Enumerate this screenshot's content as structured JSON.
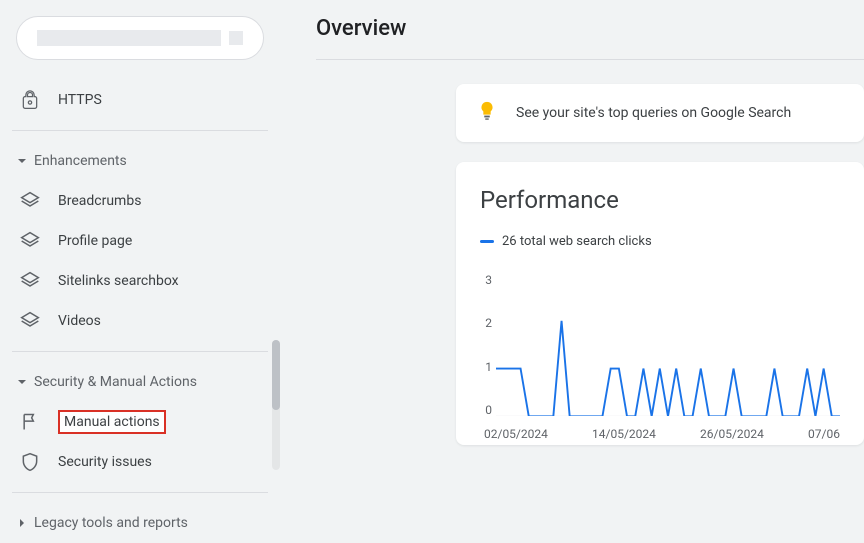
{
  "sidebar": {
    "https": {
      "label": "HTTPS"
    },
    "enhancements": {
      "label": "Enhancements",
      "items": [
        {
          "label": "Breadcrumbs"
        },
        {
          "label": "Profile page"
        },
        {
          "label": "Sitelinks searchbox"
        },
        {
          "label": "Videos"
        }
      ]
    },
    "security": {
      "label": "Security & Manual Actions",
      "items": [
        {
          "label": "Manual actions",
          "highlighted": true
        },
        {
          "label": "Security issues"
        }
      ]
    },
    "legacy": {
      "label": "Legacy tools and reports"
    }
  },
  "main": {
    "title": "Overview",
    "tip": "See your site's top queries on Google Search",
    "performance": {
      "title": "Performance",
      "legend": "26 total web search clicks"
    }
  },
  "chart_data": {
    "type": "line",
    "title": "Performance",
    "ylabel": "",
    "xlabel": "",
    "ylim": [
      0,
      3
    ],
    "y_ticks": [
      "3",
      "2",
      "1",
      "0"
    ],
    "x_ticks": [
      "02/05/2024",
      "14/05/2024",
      "26/05/2024",
      "07/06"
    ],
    "series": [
      {
        "name": "total web search clicks",
        "color": "#1a73e8",
        "values": [
          1,
          1,
          1,
          1,
          0,
          0,
          0,
          0,
          2,
          0,
          0,
          0,
          0,
          0,
          1,
          1,
          0,
          0,
          1,
          0,
          1,
          0,
          1,
          0,
          0,
          1,
          0,
          0,
          0,
          1,
          0,
          0,
          0,
          0,
          1,
          0,
          0,
          0,
          1,
          0,
          1,
          0,
          0
        ]
      }
    ]
  }
}
